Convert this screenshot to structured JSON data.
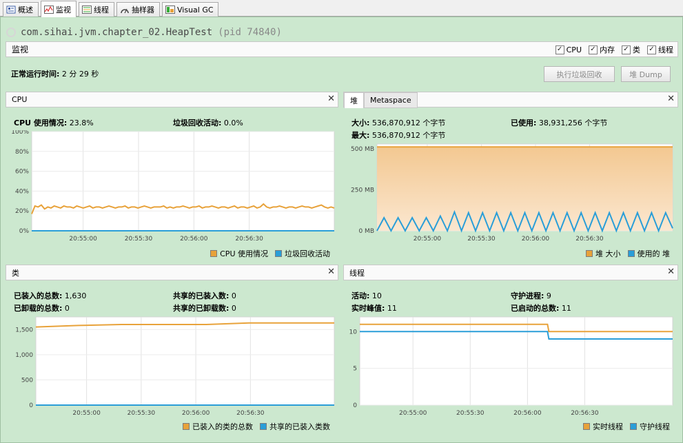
{
  "tabs": [
    {
      "label": "概述",
      "icon": "overview-icon"
    },
    {
      "label": "监视",
      "icon": "monitor-icon"
    },
    {
      "label": "线程",
      "icon": "threads-icon"
    },
    {
      "label": "抽样器",
      "icon": "sampler-icon"
    },
    {
      "label": "Visual GC",
      "icon": "visualgc-icon"
    }
  ],
  "app": {
    "title": "com.sihai.jvm.chapter_02.HeapTest",
    "pid": "(pid 74840)"
  },
  "monitor": {
    "title": "监视",
    "checks": [
      {
        "label": "CPU",
        "checked": true
      },
      {
        "label": "内存",
        "checked": true
      },
      {
        "label": "类",
        "checked": true
      },
      {
        "label": "线程",
        "checked": true
      }
    ],
    "uptime_label": "正常运行时间:",
    "uptime_value": "2 分 29 秒",
    "gc_button": "执行垃圾回收",
    "dump_button": "堆 Dump"
  },
  "colors": {
    "orange": "#e8a23a",
    "blue": "#2a9ed8",
    "bg": "#cce8cf"
  },
  "cpu": {
    "title": "CPU",
    "usage_label": "CPU 使用情况:",
    "usage_value": "23.8%",
    "gc_label": "垃圾回收活动:",
    "gc_value": "0.0%",
    "legend": [
      "CPU 使用情况",
      "垃圾回收活动"
    ]
  },
  "heap": {
    "tab_heap": "堆",
    "tab_meta": "Metaspace",
    "size_label": "大小:",
    "size_value": "536,870,912 个字节",
    "used_label": "已使用:",
    "used_value": "38,931,256 个字节",
    "max_label": "最大:",
    "max_value": "536,870,912 个字节",
    "legend": [
      "堆 大小",
      "使用的 堆"
    ]
  },
  "classes": {
    "title": "类",
    "loaded_label": "已装入的总数:",
    "loaded_value": "1,630",
    "unloaded_label": "已卸载的总数:",
    "unloaded_value": "0",
    "shared_loaded_label": "共享的已装入数:",
    "shared_loaded_value": "0",
    "shared_unloaded_label": "共享的已卸载数:",
    "shared_unloaded_value": "0",
    "legend": [
      "已装入的类的总数",
      "共享的已装入类数"
    ]
  },
  "threads": {
    "title": "线程",
    "live_label": "活动:",
    "live_value": "10",
    "peak_label": "实时峰值:",
    "peak_value": "11",
    "daemon_label": "守护进程:",
    "daemon_value": "9",
    "started_label": "已启动的总数:",
    "started_value": "11",
    "legend": [
      "实时线程",
      "守护线程"
    ]
  },
  "chart_data": [
    {
      "type": "line",
      "name": "cpu",
      "x_ticks": [
        "20:55:00",
        "20:55:30",
        "20:56:00",
        "20:56:30"
      ],
      "y_ticks": [
        "0%",
        "20%",
        "40%",
        "60%",
        "80%",
        "100%"
      ],
      "ylim": [
        0,
        100
      ],
      "series": [
        {
          "name": "CPU 使用情况",
          "values": [
            17,
            25,
            24,
            26,
            22,
            24,
            23,
            25,
            24,
            23,
            25,
            24,
            24,
            23,
            25,
            24,
            23,
            24,
            25,
            23,
            24,
            24,
            23,
            24,
            25,
            24,
            23,
            24,
            24,
            25,
            23,
            24,
            24,
            23,
            24,
            25,
            24,
            23,
            24,
            24,
            24,
            25,
            23,
            24,
            23,
            24,
            24,
            25,
            24,
            23,
            24,
            24,
            25,
            23,
            24,
            24,
            25,
            24,
            23,
            24,
            24,
            23,
            24,
            25,
            23,
            24,
            24,
            23,
            24,
            25,
            23,
            24,
            27,
            24,
            23,
            24,
            24,
            25,
            24,
            23,
            24,
            24,
            23,
            24,
            25,
            24,
            24,
            23,
            24,
            25,
            26,
            24,
            23,
            24,
            23
          ]
        },
        {
          "name": "垃圾回收活动",
          "values": [
            0,
            0
          ]
        }
      ]
    },
    {
      "type": "area",
      "name": "heap",
      "x_ticks": [
        "20:55:00",
        "20:55:30",
        "20:56:00",
        "20:56:30"
      ],
      "y_ticks": [
        "0 MB",
        "250 MB",
        "500 MB"
      ],
      "ylim": [
        0,
        530
      ],
      "series": [
        {
          "name": "堆 大小",
          "values": [
            512,
            512
          ]
        },
        {
          "name": "使用的 堆",
          "values": [
            0,
            80,
            0,
            80,
            0,
            80,
            0,
            80,
            0,
            90,
            0,
            115,
            0,
            110,
            0,
            110,
            0,
            110,
            0,
            110,
            0,
            110,
            0,
            110,
            0,
            110,
            0,
            110,
            0,
            110,
            0,
            110,
            0,
            110,
            0,
            110,
            0,
            110,
            0,
            110,
            0,
            110,
            15
          ]
        }
      ]
    },
    {
      "type": "line",
      "name": "classes",
      "x_ticks": [
        "20:55:00",
        "20:55:30",
        "20:56:00",
        "20:56:30"
      ],
      "y_ticks": [
        "0",
        "500",
        "1,000",
        "1,500"
      ],
      "ylim": [
        0,
        1750
      ],
      "series": [
        {
          "name": "已装入的类的总数",
          "values": [
            1550,
            1580,
            1600,
            1600,
            1600,
            1630,
            1630,
            1630
          ]
        },
        {
          "name": "共享的已装入类数",
          "values": [
            0,
            0
          ]
        }
      ]
    },
    {
      "type": "line",
      "name": "threads",
      "x_ticks": [
        "20:55:00",
        "20:55:30",
        "20:56:00",
        "20:56:30"
      ],
      "y_ticks": [
        "0",
        "5",
        "10"
      ],
      "ylim": [
        0,
        12
      ],
      "series": [
        {
          "name": "实时线程",
          "values": [
            11,
            11,
            11,
            10,
            10
          ]
        },
        {
          "name": "守护线程",
          "values": [
            10,
            10,
            10,
            9,
            9
          ]
        }
      ]
    }
  ]
}
